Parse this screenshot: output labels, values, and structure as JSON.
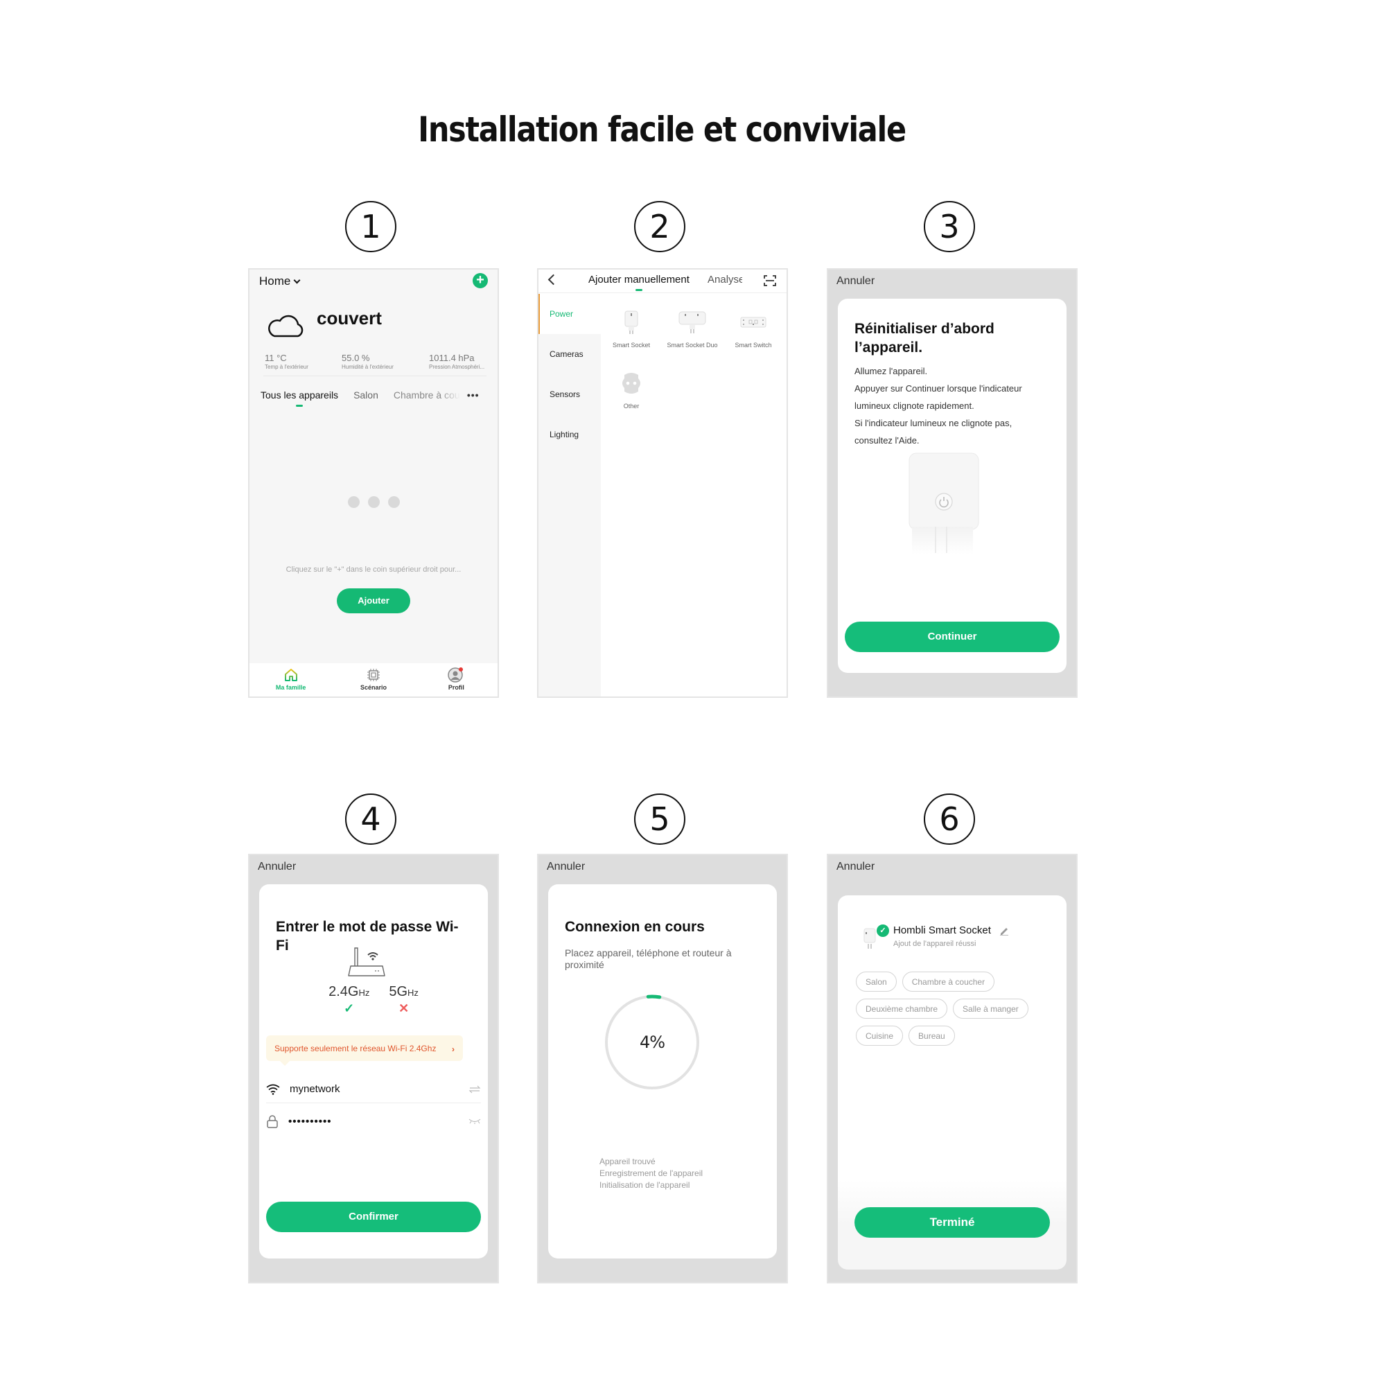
{
  "title": "Installation facile et conviviale",
  "steps": [
    "1",
    "2",
    "3",
    "4",
    "5",
    "6"
  ],
  "colors": {
    "accent": "#15b974",
    "warning": "#e0552c",
    "active_tab_indicator": "#e89b3a"
  },
  "phone1": {
    "home_label": "Home",
    "add_icon": "plus-circle-icon",
    "weather_icon": "cloud-icon",
    "weather": "couvert",
    "stats": [
      {
        "value": "11 °C",
        "label": "Temp à l'extérieur"
      },
      {
        "value": "55.0 %",
        "label": "Humidité à l'extérieur"
      },
      {
        "value": "1011.4 hPa",
        "label": "Pression Atmosphéri..."
      }
    ],
    "tabs": [
      "Tous les appareils",
      "Salon",
      "Chambre à coucher"
    ],
    "more_label": "•••",
    "empty_hint": "Cliquez sur le \"+\" dans le coin supérieur droit pour...",
    "add_button": "Ajouter",
    "bottom_nav": [
      {
        "label": "Ma famille",
        "icon": "home-icon",
        "active": true
      },
      {
        "label": "Scénario",
        "icon": "chip-icon",
        "active": false
      },
      {
        "label": "Profil",
        "icon": "profile-icon",
        "active": false,
        "badge": true
      }
    ]
  },
  "phone2": {
    "tab_manual": "Ajouter manuellement",
    "tab_scan": "Analyser",
    "categories": [
      "Power",
      "Cameras",
      "Sensors",
      "Lighting"
    ],
    "active_category": "Power",
    "devices": [
      {
        "name": "Smart Socket",
        "icon": "smart-socket-icon"
      },
      {
        "name": "Smart Socket Duo",
        "icon": "smart-socket-duo-icon"
      },
      {
        "name": "Smart Switch",
        "icon": "smart-switch-icon"
      },
      {
        "name": "Other",
        "icon": "outlet-icon"
      }
    ]
  },
  "phone3": {
    "cancel": "Annuler",
    "heading": "Réinitialiser d’abord l’appareil.",
    "lines": [
      "Allumez l'appareil.",
      "Appuyer sur Continuer lorsque l'indicateur lumineux clignote rapidement.",
      "Si l'indicateur lumineux ne clignote pas, consultez l'Aide."
    ],
    "button": "Continuer"
  },
  "phone4": {
    "cancel": "Annuler",
    "heading": "Entrer le mot de passe Wi-Fi",
    "freqs": [
      {
        "value": "2.4G",
        "unit": "Hz",
        "supported": true,
        "mark": "✓"
      },
      {
        "value": "5G",
        "unit": "Hz",
        "supported": false,
        "mark": "✕"
      }
    ],
    "tip": "Supporte seulement le réseau Wi-Fi 2.4Ghz",
    "ssid": "mynetwork",
    "password_masked": "••••••••••",
    "button": "Confirmer"
  },
  "phone5": {
    "cancel": "Annuler",
    "heading": "Connexion en cours",
    "subtitle": "Placez appareil, téléphone et routeur à proximité",
    "progress_percent": 4,
    "progress_label": "4%",
    "steps": [
      "Appareil trouvé",
      "Enregistrement de l'appareil",
      "Initialisation de l'appareil"
    ]
  },
  "phone6": {
    "cancel": "Annuler",
    "device_name": "Hombli Smart Socket",
    "device_status": "Ajout de l'appareil réussi",
    "rooms": [
      "Salon",
      "Chambre à coucher",
      "Deuxième chambre",
      "Salle à manger",
      "Cuisine",
      "Bureau"
    ],
    "button": "Terminé"
  }
}
